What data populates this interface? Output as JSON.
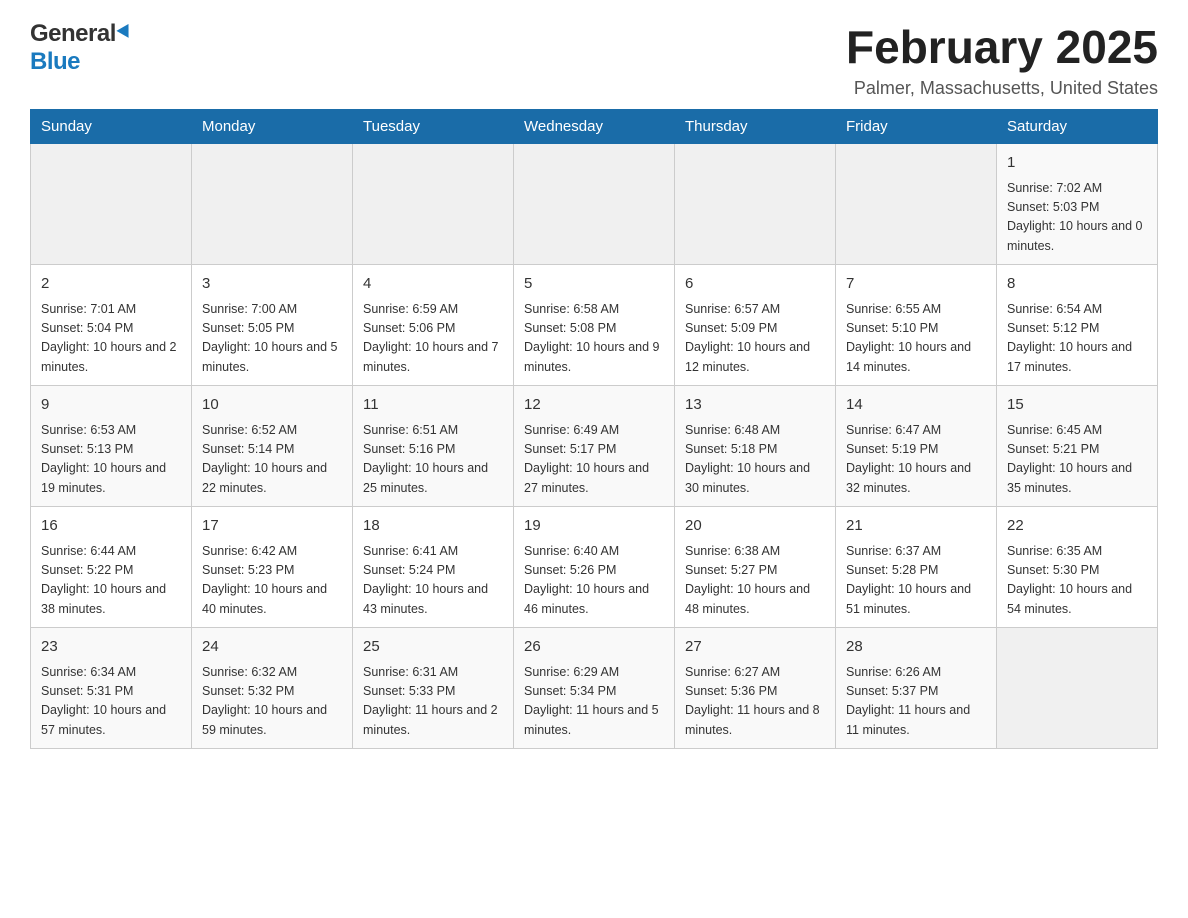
{
  "header": {
    "logo_general": "General",
    "logo_blue": "Blue",
    "month_title": "February 2025",
    "location": "Palmer, Massachusetts, United States"
  },
  "days_of_week": [
    "Sunday",
    "Monday",
    "Tuesday",
    "Wednesday",
    "Thursday",
    "Friday",
    "Saturday"
  ],
  "weeks": [
    [
      {
        "day": "",
        "info": ""
      },
      {
        "day": "",
        "info": ""
      },
      {
        "day": "",
        "info": ""
      },
      {
        "day": "",
        "info": ""
      },
      {
        "day": "",
        "info": ""
      },
      {
        "day": "",
        "info": ""
      },
      {
        "day": "1",
        "info": "Sunrise: 7:02 AM\nSunset: 5:03 PM\nDaylight: 10 hours and 0 minutes."
      }
    ],
    [
      {
        "day": "2",
        "info": "Sunrise: 7:01 AM\nSunset: 5:04 PM\nDaylight: 10 hours and 2 minutes."
      },
      {
        "day": "3",
        "info": "Sunrise: 7:00 AM\nSunset: 5:05 PM\nDaylight: 10 hours and 5 minutes."
      },
      {
        "day": "4",
        "info": "Sunrise: 6:59 AM\nSunset: 5:06 PM\nDaylight: 10 hours and 7 minutes."
      },
      {
        "day": "5",
        "info": "Sunrise: 6:58 AM\nSunset: 5:08 PM\nDaylight: 10 hours and 9 minutes."
      },
      {
        "day": "6",
        "info": "Sunrise: 6:57 AM\nSunset: 5:09 PM\nDaylight: 10 hours and 12 minutes."
      },
      {
        "day": "7",
        "info": "Sunrise: 6:55 AM\nSunset: 5:10 PM\nDaylight: 10 hours and 14 minutes."
      },
      {
        "day": "8",
        "info": "Sunrise: 6:54 AM\nSunset: 5:12 PM\nDaylight: 10 hours and 17 minutes."
      }
    ],
    [
      {
        "day": "9",
        "info": "Sunrise: 6:53 AM\nSunset: 5:13 PM\nDaylight: 10 hours and 19 minutes."
      },
      {
        "day": "10",
        "info": "Sunrise: 6:52 AM\nSunset: 5:14 PM\nDaylight: 10 hours and 22 minutes."
      },
      {
        "day": "11",
        "info": "Sunrise: 6:51 AM\nSunset: 5:16 PM\nDaylight: 10 hours and 25 minutes."
      },
      {
        "day": "12",
        "info": "Sunrise: 6:49 AM\nSunset: 5:17 PM\nDaylight: 10 hours and 27 minutes."
      },
      {
        "day": "13",
        "info": "Sunrise: 6:48 AM\nSunset: 5:18 PM\nDaylight: 10 hours and 30 minutes."
      },
      {
        "day": "14",
        "info": "Sunrise: 6:47 AM\nSunset: 5:19 PM\nDaylight: 10 hours and 32 minutes."
      },
      {
        "day": "15",
        "info": "Sunrise: 6:45 AM\nSunset: 5:21 PM\nDaylight: 10 hours and 35 minutes."
      }
    ],
    [
      {
        "day": "16",
        "info": "Sunrise: 6:44 AM\nSunset: 5:22 PM\nDaylight: 10 hours and 38 minutes."
      },
      {
        "day": "17",
        "info": "Sunrise: 6:42 AM\nSunset: 5:23 PM\nDaylight: 10 hours and 40 minutes."
      },
      {
        "day": "18",
        "info": "Sunrise: 6:41 AM\nSunset: 5:24 PM\nDaylight: 10 hours and 43 minutes."
      },
      {
        "day": "19",
        "info": "Sunrise: 6:40 AM\nSunset: 5:26 PM\nDaylight: 10 hours and 46 minutes."
      },
      {
        "day": "20",
        "info": "Sunrise: 6:38 AM\nSunset: 5:27 PM\nDaylight: 10 hours and 48 minutes."
      },
      {
        "day": "21",
        "info": "Sunrise: 6:37 AM\nSunset: 5:28 PM\nDaylight: 10 hours and 51 minutes."
      },
      {
        "day": "22",
        "info": "Sunrise: 6:35 AM\nSunset: 5:30 PM\nDaylight: 10 hours and 54 minutes."
      }
    ],
    [
      {
        "day": "23",
        "info": "Sunrise: 6:34 AM\nSunset: 5:31 PM\nDaylight: 10 hours and 57 minutes."
      },
      {
        "day": "24",
        "info": "Sunrise: 6:32 AM\nSunset: 5:32 PM\nDaylight: 10 hours and 59 minutes."
      },
      {
        "day": "25",
        "info": "Sunrise: 6:31 AM\nSunset: 5:33 PM\nDaylight: 11 hours and 2 minutes."
      },
      {
        "day": "26",
        "info": "Sunrise: 6:29 AM\nSunset: 5:34 PM\nDaylight: 11 hours and 5 minutes."
      },
      {
        "day": "27",
        "info": "Sunrise: 6:27 AM\nSunset: 5:36 PM\nDaylight: 11 hours and 8 minutes."
      },
      {
        "day": "28",
        "info": "Sunrise: 6:26 AM\nSunset: 5:37 PM\nDaylight: 11 hours and 11 minutes."
      },
      {
        "day": "",
        "info": ""
      }
    ]
  ]
}
